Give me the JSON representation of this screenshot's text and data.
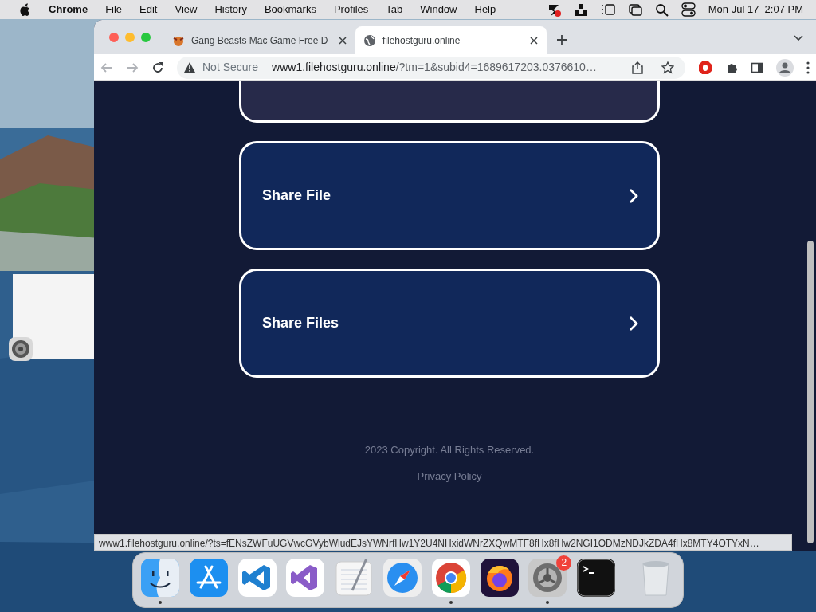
{
  "menu_bar": {
    "app": "Chrome",
    "menus": [
      "File",
      "Edit",
      "View",
      "History",
      "Bookmarks",
      "Profiles",
      "Tab",
      "Window",
      "Help"
    ],
    "clock": "Mon Jul 17  2:07 PM"
  },
  "browser": {
    "tabs": [
      {
        "title": "Gang Beasts Mac Game Free D",
        "selected": false
      },
      {
        "title": "filehostguru.online",
        "selected": true
      }
    ],
    "address_bar": {
      "security": "Not Secure",
      "url_host": "www1.filehostguru.online",
      "url_rest": "/?tm=1&subid4=1689617203.0376610…"
    },
    "page": {
      "cards": [
        {
          "kind": "partial"
        },
        {
          "kind": "link",
          "label": "Share File"
        },
        {
          "kind": "link",
          "label": "Share Files"
        }
      ],
      "footer": {
        "copyright": "2023 Copyright. All Rights Reserved.",
        "privacy_link": "Privacy Policy"
      }
    },
    "status_url": "www1.filehostguru.online/?ts=fENsZWFuUGVwcGVybWludEJsYWNrfHw1Y2U4NHxidWNrZXQwMTF8fHx8fHw2NGI1ODMzNDJkZDA4fHx8MTY4OTYxN…"
  },
  "dock": {
    "apps": [
      {
        "kind": "finder",
        "running": true
      },
      {
        "kind": "appstore",
        "running": false
      },
      {
        "kind": "vscode",
        "running": false
      },
      {
        "kind": "visualstudio",
        "running": false
      },
      {
        "kind": "textedit",
        "running": false
      },
      {
        "kind": "safari",
        "running": false
      },
      {
        "kind": "chrome",
        "running": true
      },
      {
        "kind": "firefox",
        "running": false
      },
      {
        "kind": "settings",
        "running": true,
        "badge": "2"
      },
      {
        "kind": "terminal",
        "running": false
      },
      {
        "kind": "trash",
        "running": false
      }
    ]
  }
}
